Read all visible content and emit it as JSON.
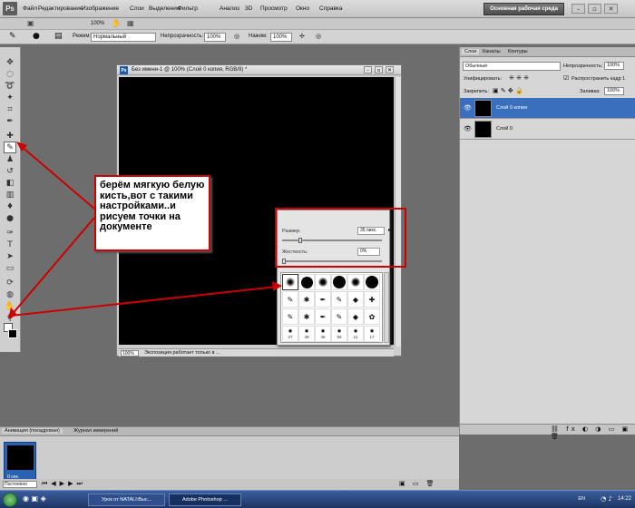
{
  "menubar": {
    "logo": "Ps",
    "items": [
      "Файл",
      "Редактирование",
      "Изображение",
      "Слои",
      "Выделение",
      "Фильтр",
      "Анализ",
      "3D",
      "Просмотр",
      "Окно",
      "Справка"
    ],
    "zoom": "100%",
    "workspace": "Основная рабочая среда"
  },
  "options_bar": {
    "mode_label": "Режим:",
    "mode_value": "Нормальный",
    "opacity_label": "Непрозрачность:",
    "opacity_value": "100%",
    "flow_label": "Нажим:",
    "flow_value": "100%"
  },
  "document": {
    "title": "Без имени-1 @ 100% (Слой 0 копия, RGB/8) *",
    "zoom": "100%",
    "status": "Экспозиция работает только в ..."
  },
  "brush_panel": {
    "size_label": "Размер:",
    "size_value": "35 пикс.",
    "hardness_label": "Жесткость:",
    "hardness_value": "0%",
    "brush_numbers": [
      "27",
      "39",
      "46",
      "59",
      "11",
      "17"
    ]
  },
  "annotation": {
    "text": "берём мягкую белую кисть,вот с такими настройками..и рисуем точки на документе",
    "color": "#cc0000"
  },
  "layers_panel": {
    "tabs": [
      "Слои",
      "Каналы",
      "Контуры"
    ],
    "blend_mode": "Обычные",
    "opacity_label": "Непрозрачность:",
    "opacity_value": "100%",
    "unify_label": "Унифицировать:",
    "propagate_label": "Распространить кадр 1",
    "lock_label": "Закрепить:",
    "fill_label": "Заливка:",
    "fill_value": "100%",
    "layers": [
      {
        "name": "Слой 0 копия",
        "selected": true
      },
      {
        "name": "Слой 0",
        "selected": false
      }
    ]
  },
  "animation_panel": {
    "tabs": [
      "Анимация (покадровая)",
      "Журнал измерений"
    ],
    "frame_label": "0 сек.",
    "loop": "Постоянно"
  },
  "taskbar": {
    "tasks": [
      "Урок от NATALI:Выс...",
      "Adobe Photoshop ..."
    ],
    "language": "EN",
    "clock": "14:22"
  }
}
